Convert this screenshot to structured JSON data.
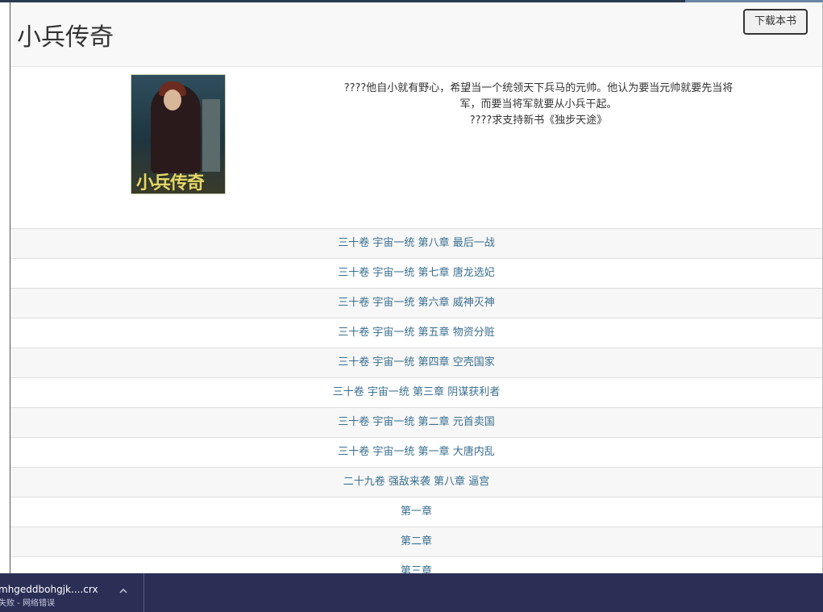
{
  "book": {
    "title": "小兵传奇",
    "download_label": "下载本书",
    "cover_text": "小兵传奇",
    "synopsis": [
      "????他自小就有野心，希望当一个统领天下兵马的元帅。他认为要当元帅就要先当将军，而要当将军就要从小兵干起。",
      "????求支持新书《独步天途》"
    ]
  },
  "chapters": [
    "三十卷 宇宙一统 第八章 最后一战",
    "三十卷 宇宙一统 第七章 唐龙选妃",
    "三十卷 宇宙一统 第六章 威神灭神",
    "三十卷 宇宙一统 第五章 物资分赃",
    "三十卷 宇宙一统 第四章 空壳国家",
    "三十卷 宇宙一统 第三章 阴谋获利者",
    "三十卷 宇宙一统 第二章 元首卖国",
    "三十卷 宇宙一统 第一章 大唐内乱",
    "二十九卷 强敌来袭 第八章 逼宫",
    "第一章",
    "第二章",
    "第三章"
  ],
  "download_bar": {
    "filename": "mhgeddbohgjk....crx",
    "status": "失败 - 网络错误",
    "chevron_icon": "chevron-up-icon"
  },
  "colors": {
    "link": "#3a6f8f",
    "download_bar_bg": "#2b2f56",
    "header_bg": "#f8f8f8"
  }
}
